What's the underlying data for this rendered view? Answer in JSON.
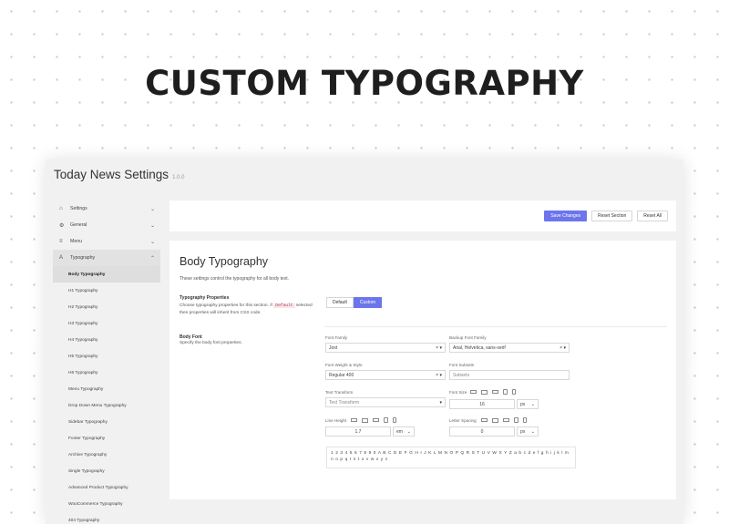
{
  "hero": {
    "title": "CUSTOM TYPOGRAPHY"
  },
  "window": {
    "title": "Today News Settings",
    "version": "1.0.0"
  },
  "sidebar": {
    "items": [
      {
        "label": "Settings",
        "icon": "home-icon"
      },
      {
        "label": "General",
        "icon": "gear-icon"
      },
      {
        "label": "Menu",
        "icon": "menu-icon"
      },
      {
        "label": "Typography",
        "icon": "typography-icon"
      }
    ],
    "subitems": [
      "Body Typography",
      "H1 Typography",
      "H2 Typography",
      "H3 Typography",
      "H4 Typography",
      "H5 Typography",
      "H6 Typography",
      "Menu Typography",
      "Drop Down Menu Typography",
      "Sidebar Typography",
      "Footer Typography",
      "Archive Typography",
      "Single Typography",
      "Advanced Product Typography",
      "WooCommerce Typography",
      "404 Typography"
    ]
  },
  "toolbar": {
    "save": "Save Changes",
    "reset_section": "Reset Section",
    "reset_all": "Reset All"
  },
  "panel": {
    "title": "Body Typography",
    "desc": "These settings control the typography for all body text.",
    "typo_props": {
      "title": "Typography Properties",
      "desc_a": "Choose typography properties for this section. If",
      "code": "Default",
      "desc_b": "selected then properties will inherit from CSS code.",
      "opt_default": "Default",
      "opt_custom": "Custom"
    },
    "body_font": {
      "title": "Body Font",
      "desc": "Specify the body font properties."
    },
    "fields": {
      "font_family_label": "Font Family",
      "font_family_value": "Jost",
      "backup_label": "Backup Font Family",
      "backup_value": "Arial, Helvetica, sans-serif",
      "weight_label": "Font Weight & Style",
      "weight_value": "Regular 400",
      "subsets_label": "Font Subsets",
      "subsets_placeholder": "Subsets",
      "transform_label": "Text Transform",
      "transform_placeholder": "Text Transform",
      "size_label": "Font Size",
      "size_value": "16",
      "size_unit": "px",
      "lh_label": "Line Height",
      "lh_value": "1.7",
      "lh_unit": "em",
      "ls_label": "Letter Spacing",
      "ls_value": "0",
      "ls_unit": "px"
    },
    "preview": "1 2 3 4 5 6 7 8 9 0 A B C D E F G H I J K L M N O P Q R S T U V W X Y Z a b c d e f g h i j k l m n o p q r s t u v w x y z"
  },
  "colors": {
    "accent": "#6c75ec"
  }
}
